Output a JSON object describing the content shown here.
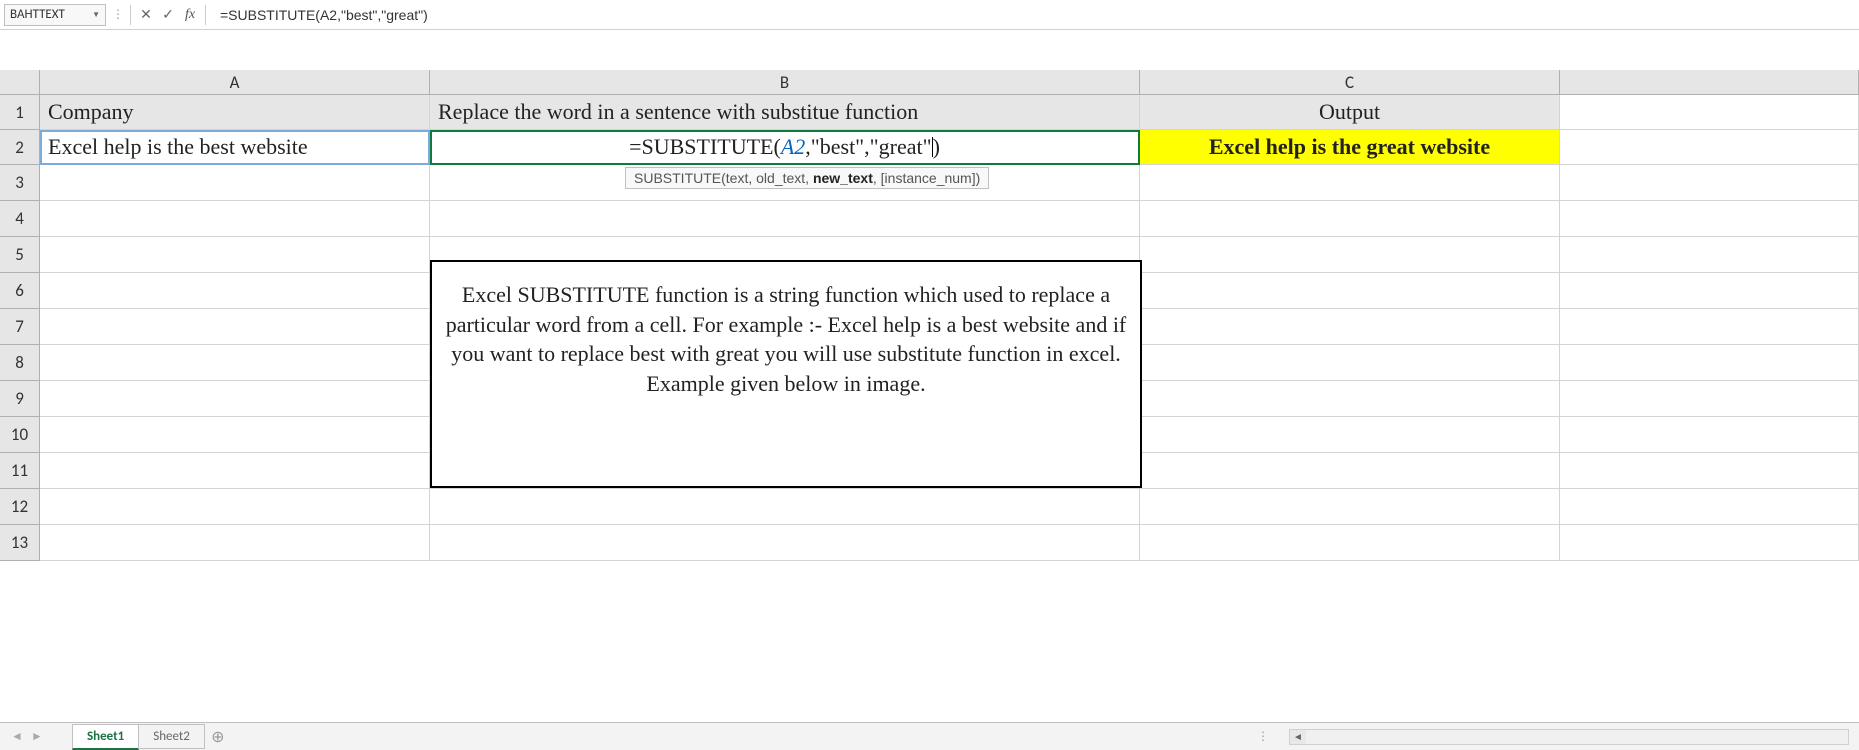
{
  "name_box": "BAHTTEXT",
  "formula_bar": "=SUBSTITUTE(A2,\"best\",\"great\")",
  "columns": {
    "A": "A",
    "B": "B",
    "C": "C"
  },
  "rows": [
    "1",
    "2",
    "3",
    "4",
    "5",
    "6",
    "7",
    "8",
    "9",
    "10",
    "11",
    "12",
    "13"
  ],
  "cells": {
    "A1": "Company",
    "B1": "Replace the word in a sentence with substitue function",
    "C1": "Output",
    "A2": "Excel help is the best website",
    "B2_prefix": "=SUBSTITUTE(",
    "B2_ref": "A2",
    "B2_suffix": ",\"best\",\"great\"",
    "B2_close": ")",
    "C2": "Excel help is the great website"
  },
  "tooltip": {
    "fn": "SUBSTITUTE",
    "open": "(text, old_text, ",
    "bold": "new_text",
    "close": ", [instance_num])"
  },
  "description": "Excel SUBSTITUTE function is a string function which used to replace a particular word from a cell. For example :- Excel help is a best website and if you want to replace best with great you will use substitute function in excel. Example given below in image.",
  "sheets": {
    "active": "Sheet1",
    "inactive": "Sheet2"
  }
}
